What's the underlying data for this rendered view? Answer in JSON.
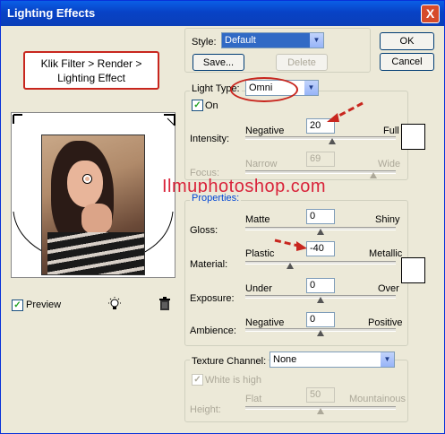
{
  "window": {
    "title": "Lighting Effects",
    "close_symbol": "X"
  },
  "buttons": {
    "ok": "OK",
    "cancel": "Cancel",
    "save": "Save...",
    "delete": "Delete"
  },
  "style": {
    "label": "Style:",
    "value": "Default"
  },
  "light_type": {
    "label": "Light Type:",
    "value": "Omni",
    "on_label": "On",
    "on_checked": true
  },
  "intensity": {
    "label": "Intensity:",
    "left": "Negative",
    "right": "Full",
    "value": "20",
    "level": 0.58
  },
  "focus": {
    "label": "Focus:",
    "left": "Narrow",
    "right": "Wide",
    "value": "69",
    "level": 0.85
  },
  "properties": {
    "heading": "Properties:",
    "gloss": {
      "label": "Gloss:",
      "left": "Matte",
      "right": "Shiny",
      "value": "0",
      "level": 0.5
    },
    "material": {
      "label": "Material:",
      "left": "Plastic",
      "right": "Metallic",
      "value": "-40",
      "level": 0.3
    },
    "exposure": {
      "label": "Exposure:",
      "left": "Under",
      "right": "Over",
      "value": "0",
      "level": 0.5
    },
    "ambience": {
      "label": "Ambience:",
      "left": "Negative",
      "right": "Positive",
      "value": "0",
      "level": 0.5
    }
  },
  "texture": {
    "channel_label": "Texture Channel:",
    "channel_value": "None",
    "white_is_high": "White is high",
    "height_label": "Height:",
    "left": "Flat",
    "right": "Mountainous",
    "value": "50",
    "level": 0.5
  },
  "preview": {
    "label": "Preview",
    "checked": true
  },
  "annotation": {
    "callout": "Klik Filter > Render > Lighting Effect",
    "watermark": "Ilmuphotoshop.com"
  },
  "colors": {
    "accent_red": "#c8261e",
    "title_blue": "#0842c6"
  },
  "icons": {
    "light_bulb": "light-bulb-icon",
    "trash": "trash-icon"
  }
}
